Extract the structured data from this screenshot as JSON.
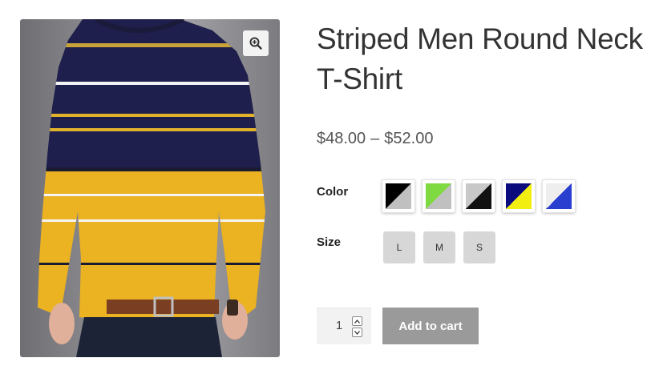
{
  "product": {
    "title": "Striped Men Round Neck T-Shirt",
    "price_min": "$48.00",
    "price_separator": "–",
    "price_max": "$52.00",
    "image_alt": "Striped Men Round Neck T-Shirt"
  },
  "variations": {
    "color": {
      "label": "Color",
      "swatches": [
        {
          "name": "black-grey",
          "primary": "#000000",
          "secondary": "#c0c0c0"
        },
        {
          "name": "green-grey",
          "primary": "#7fd941",
          "secondary": "#c0c0c0"
        },
        {
          "name": "grey-black",
          "primary": "#c8c8c8",
          "secondary": "#111111"
        },
        {
          "name": "navy-yellow",
          "primary": "#0b0b7e",
          "secondary": "#f2ee12"
        },
        {
          "name": "white-blue",
          "primary": "#eeeeee",
          "secondary": "#2a3fcf"
        }
      ]
    },
    "size": {
      "label": "Size",
      "options": [
        "L",
        "M",
        "S"
      ]
    }
  },
  "cart": {
    "quantity": "1",
    "add_label": "Add to cart"
  },
  "colors": {
    "navy": "#1f1f4d",
    "yellow": "#ebb221",
    "button_grey": "#9a9a9a"
  },
  "icons": {
    "zoom": "zoom-in-icon"
  }
}
